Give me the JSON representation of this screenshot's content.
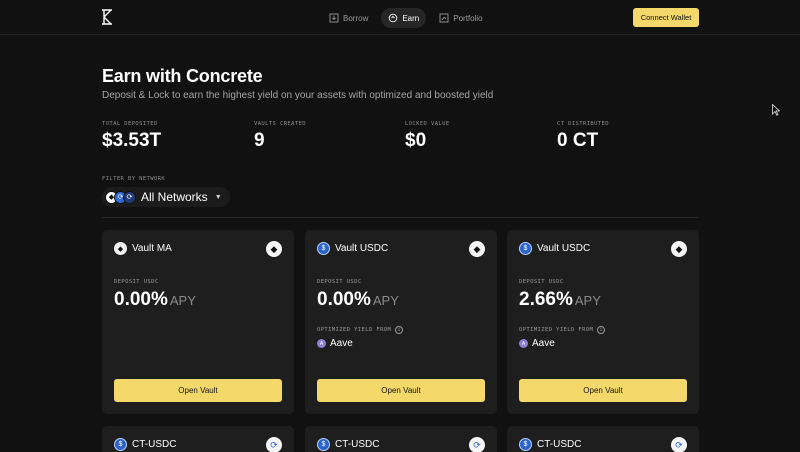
{
  "nav": {
    "items": [
      {
        "label": "Borrow",
        "icon": "download-box-icon",
        "active": false
      },
      {
        "label": "Earn",
        "icon": "earn-cycle-icon",
        "active": true
      },
      {
        "label": "Portfolio",
        "icon": "chart-box-icon",
        "active": false
      }
    ],
    "connect_label": "Connect Wallet"
  },
  "hero": {
    "title": "Earn with Concrete",
    "subtitle": "Deposit & Lock to earn the highest yield on your assets with optimized and boosted yield"
  },
  "stats": [
    {
      "label": "TOTAL DEPOSITED",
      "value": "$3.53T"
    },
    {
      "label": "VAULTS CREATED",
      "value": "9"
    },
    {
      "label": "LOCKED VALUE",
      "value": "$0"
    },
    {
      "label": "CT DISTRIBUTED",
      "value": "0 CT"
    }
  ],
  "filter": {
    "label": "FILTER BY NETWORK",
    "selected": "All Networks"
  },
  "vaults": [
    {
      "name": "Vault MA",
      "asset_icon": "eth",
      "chain_icon": "eth",
      "deposit_label": "DEPOSIT USDC",
      "apy": "0.00%",
      "apy_unit": "APY",
      "optimized_label": "",
      "protocol": ""
    },
    {
      "name": "Vault USDC",
      "asset_icon": "usdc",
      "chain_icon": "eth",
      "deposit_label": "DEPOSIT USDC",
      "apy": "0.00%",
      "apy_unit": "APY",
      "optimized_label": "OPTIMIZED YIELD FROM",
      "protocol": "Aave"
    },
    {
      "name": "Vault USDC",
      "asset_icon": "usdc",
      "chain_icon": "eth",
      "deposit_label": "DEPOSIT USDC",
      "apy": "2.66%",
      "apy_unit": "APY",
      "optimized_label": "OPTIMIZED YIELD FROM",
      "protocol": "Aave"
    }
  ],
  "open_vault_label": "Open Vault",
  "next_row": [
    {
      "name": "CT-USDC"
    },
    {
      "name": "CT-USDC"
    },
    {
      "name": "CT-USDC"
    }
  ],
  "colors": {
    "background": "#111111",
    "card": "#1e1e1e",
    "accent": "#f5d86a",
    "usdc": "#2a63c9"
  }
}
